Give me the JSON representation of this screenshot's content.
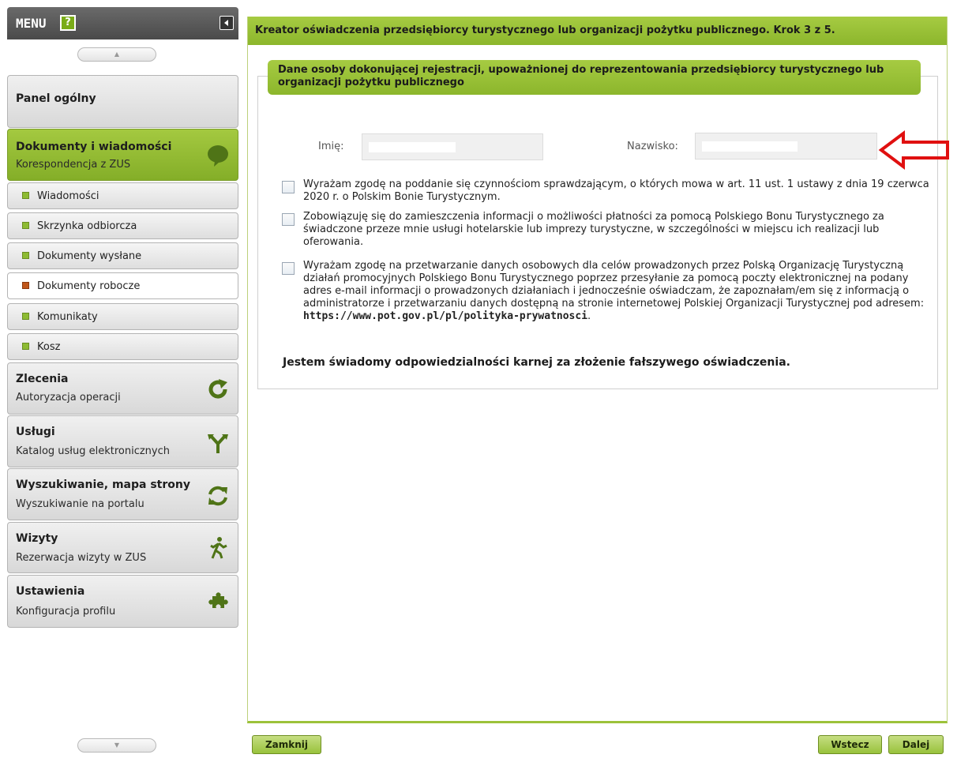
{
  "menu": {
    "title": "MENU",
    "help_label": "?",
    "scroll_up_glyph": "▲",
    "scroll_down_glyph": "▼"
  },
  "sidebar": {
    "sections": [
      {
        "title": "Panel ogólny"
      },
      {
        "title": "Dokumenty i wiadomości",
        "subtitle": "Korespondencja z ZUS",
        "icon": "speech-bubble-icon"
      },
      {
        "title": "Zlecenia",
        "subtitle": "Autoryzacja operacji",
        "icon": "refresh-icon"
      },
      {
        "title": "Usługi",
        "subtitle": "Katalog usług elektronicznych",
        "icon": "branch-icon"
      },
      {
        "title": "Wyszukiwanie, mapa strony",
        "subtitle": "Wyszukiwanie na portalu",
        "icon": "sync-icon"
      },
      {
        "title": "Wizyty",
        "subtitle": "Rezerwacja wizyty w ZUS",
        "icon": "walking-person-icon"
      },
      {
        "title": "Ustawienia",
        "subtitle": "Konfiguracja profilu",
        "icon": "puzzle-icon"
      }
    ],
    "sub_items": [
      {
        "label": "Wiadomości"
      },
      {
        "label": "Skrzynka odbiorcza"
      },
      {
        "label": "Dokumenty wysłane"
      },
      {
        "label": "Dokumenty robocze"
      },
      {
        "label": "Komunikaty"
      },
      {
        "label": "Kosz"
      }
    ]
  },
  "main": {
    "header": "Kreator oświadczenia przedsiębiorcy turystycznego lub organizacji pożytku publicznego. Krok 3 z 5.",
    "section_title": "Dane osoby dokonującej rejestracji, upoważnionej do reprezentowania przedsiębiorcy turystycznego lub organizacji pożytku publicznego",
    "first_name_label": "Imię:",
    "last_name_label": "Nazwisko:",
    "consents": [
      {
        "text": "Wyrażam zgodę na poddanie się czynnościom sprawdzającym, o których mowa w art. 11 ust. 1 ustawy z dnia 19 czerwca 2020 r. o Polskim Bonie Turystycznym.",
        "checked": false
      },
      {
        "text": "Zobowiązuję się do zamieszczenia informacji o możliwości płatności za pomocą Polskiego Bonu Turystycznego za świadczone przeze mnie usługi hotelarskie lub imprezy turystyczne, w szczególności w miejscu ich realizacji lub oferowania.",
        "checked": false
      },
      {
        "text": "Wyrażam zgodę na przetwarzanie danych osobowych dla celów prowadzonych przez Polską Organizację Turystyczną działań promocyjnych Polskiego Bonu Turystycznego poprzez przesyłanie za pomocą poczty elektronicznej na podany adres e-mail informacji o prowadzonych działaniach i jednocześnie oświadczam, że zapoznałam/em się z informacją o administratorze i przetwarzaniu danych dostępną na stronie internetowej Polskiej Organizacji Turystycznej pod adresem: ",
        "link": "https://www.pot.gov.pl/pl/polityka-prywatnosci",
        "suffix": ".",
        "checked": false
      }
    ],
    "statement": "Jestem świadomy odpowiedzialności karnej za złożenie fałszywego oświadczenia."
  },
  "footer": {
    "close_label": "Zamknij",
    "back_label": "Wstecz",
    "next_label": "Dalej"
  },
  "colors": {
    "accent_green": "#8cb62c",
    "annotation_red": "#e01010"
  }
}
